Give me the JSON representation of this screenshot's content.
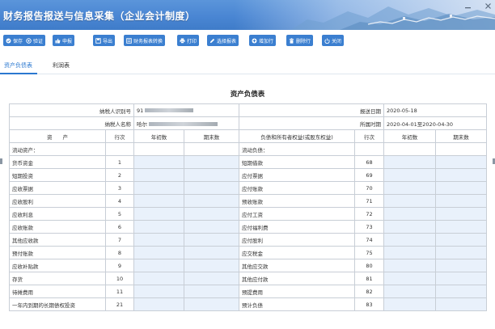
{
  "banner": {
    "title": "财务报告报送与信息采集（企业会计制度）"
  },
  "toolbar": [
    {
      "label": "保存",
      "icon": "check-circle-icon"
    },
    {
      "label": "验证",
      "icon": "target-icon"
    },
    {
      "label": "申报",
      "icon": "thumbs-up-icon"
    },
    {
      "label": "导出",
      "icon": "export-icon"
    },
    {
      "label": "财务报表转换",
      "icon": "convert-icon"
    },
    {
      "label": "打印",
      "icon": "printer-icon"
    },
    {
      "label": "选择报表",
      "icon": "pencil-icon"
    },
    {
      "label": "增加行",
      "icon": "plus-circle-icon"
    },
    {
      "label": "删除行",
      "icon": "trash-icon"
    },
    {
      "label": "关闭",
      "icon": "power-icon"
    }
  ],
  "tabs": [
    {
      "label": "资产负债表",
      "active": true
    },
    {
      "label": "利润表",
      "active": false
    }
  ],
  "sheet": {
    "title": "资产负债表",
    "taxpayer_id_label": "纳税人识别号",
    "taxpayer_id_value": "91",
    "taxpayer_name_label": "纳税人名称",
    "taxpayer_name_value": "哈尔",
    "report_date_label": "报送日期",
    "report_date_value": "2020-05-18",
    "period_label": "所属时期",
    "period_value": "2020-04-01至2020-04-30",
    "headers": {
      "assets": "资　　产",
      "row_no": "行次",
      "begin": "年初数",
      "end": "期末数",
      "liab": "负债和所有者权益(或股东权益)"
    },
    "rows": [
      {
        "left": "流动资产：",
        "lno": "",
        "right": "流动负债：",
        "rno": ""
      },
      {
        "left": "货币资金",
        "lno": "1",
        "right": "短期借款",
        "rno": "68"
      },
      {
        "left": "短期投资",
        "lno": "2",
        "right": "应付票据",
        "rno": "69"
      },
      {
        "left": "应收票据",
        "lno": "3",
        "right": "应付账款",
        "rno": "70"
      },
      {
        "left": "应收股利",
        "lno": "4",
        "right": "预收账款",
        "rno": "71"
      },
      {
        "left": "应收利息",
        "lno": "5",
        "right": "应付工资",
        "rno": "72"
      },
      {
        "left": "应收账款",
        "lno": "6",
        "right": "应付福利费",
        "rno": "73"
      },
      {
        "left": "其他应收款",
        "lno": "7",
        "right": "应付股利",
        "rno": "74"
      },
      {
        "left": "预付账款",
        "lno": "8",
        "right": "应交税金",
        "rno": "75"
      },
      {
        "left": "应收补贴款",
        "lno": "9",
        "right": "其他应交款",
        "rno": "80"
      },
      {
        "left": "存货",
        "lno": "10",
        "right": "其他应付款",
        "rno": "81"
      },
      {
        "left": "待摊费用",
        "lno": "11",
        "right": "预提费用",
        "rno": "82"
      },
      {
        "left": "一年内到期的长期债权投资",
        "lno": "21",
        "right": "预计负债",
        "rno": "83"
      }
    ]
  },
  "colors": {
    "banner": "#4a86d3",
    "button": "#3b7fd0",
    "tab_active": "#2b78d0",
    "input_cell": "#e9f1fb",
    "grid": "#c8ced6"
  }
}
